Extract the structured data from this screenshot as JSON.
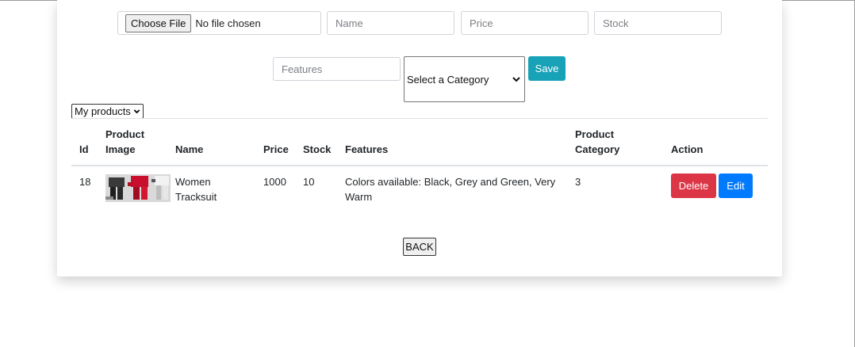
{
  "form": {
    "file_button_label": "Choose File",
    "file_status": "No file chosen",
    "name_placeholder": "Name",
    "price_placeholder": "Price",
    "stock_placeholder": "Stock",
    "features_placeholder": "Features",
    "category_selected": "Select a Category",
    "save_label": "Save"
  },
  "filter": {
    "selected": "My products"
  },
  "table": {
    "headers": {
      "id": "Id",
      "image_line1": "Product",
      "image_line2": "Image",
      "name": "Name",
      "price": "Price",
      "stock": "Stock",
      "features": "Features",
      "category_line1": "Product",
      "category_line2": "Category",
      "action": "Action"
    },
    "rows": [
      {
        "id": "18",
        "name_line1": "Women",
        "name_line2": "Tracksuit",
        "price": "1000",
        "stock": "10",
        "features_line1": "Colors available: Black, Grey and Green, Very",
        "features_line2": "Warm",
        "category": "3",
        "delete_label": "Delete",
        "edit_label": "Edit"
      }
    ]
  },
  "back_label": "BACK",
  "colors": {
    "save": "#17a2b8",
    "delete": "#dc3545",
    "edit": "#007bff"
  },
  "icons": {
    "select_arrow": "chevron-down-icon"
  }
}
